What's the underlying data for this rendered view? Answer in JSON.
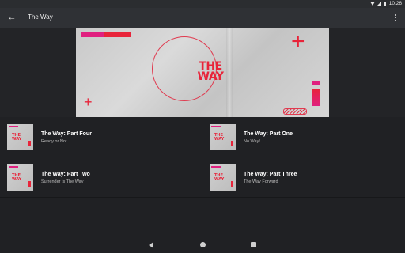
{
  "status_bar": {
    "time": "10:26"
  },
  "app_bar": {
    "title": "The Way",
    "back_icon": "arrow-left-icon",
    "overflow_icon": "more-vert-icon"
  },
  "banner": {
    "title_line1": "THE",
    "title_line2": "WAY"
  },
  "episodes": [
    {
      "title": "The Way: Part Four",
      "subtitle": "Ready or Not"
    },
    {
      "title": "The Way: Part One",
      "subtitle": "No Way!"
    },
    {
      "title": "The Way: Part Two",
      "subtitle": "Surrender Is The Way"
    },
    {
      "title": "The Way: Part Three",
      "subtitle": "The Way Forward"
    }
  ],
  "thumbnail_text": {
    "line1": "THE",
    "line2": "WAY"
  },
  "colors": {
    "accent_red": "#e8243a",
    "accent_pink": "#e0207f",
    "background": "#202124",
    "app_bar": "#2f3135"
  },
  "nav_bar": {
    "back_icon": "triangle-back-icon",
    "home_icon": "circle-home-icon",
    "recents_icon": "square-recents-icon"
  }
}
